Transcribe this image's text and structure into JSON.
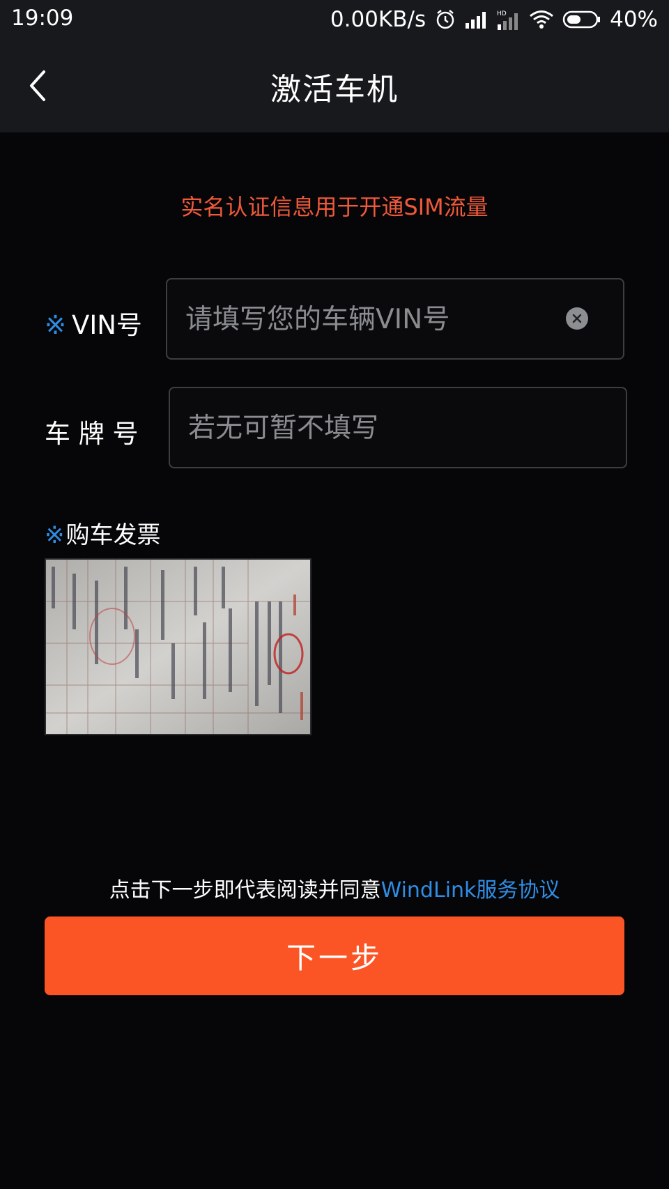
{
  "status_bar": {
    "time": "19:09",
    "network_speed": "0.00KB/s",
    "battery": "40%",
    "icons": [
      "alarm-icon",
      "signal-icon",
      "hd-signal-icon",
      "wifi-icon",
      "battery-icon"
    ]
  },
  "nav": {
    "title": "激活车机",
    "back_icon": "chevron-left-icon"
  },
  "notice": "实名认证信息用于开通SIM流量",
  "form": {
    "required_mark": "※",
    "vin": {
      "label": "VIN号",
      "placeholder": "请填写您的车辆VIN号",
      "value": ""
    },
    "plate": {
      "label": "车 牌 号",
      "placeholder": "若无可暂不填写",
      "value": ""
    },
    "invoice": {
      "label": "购车发票"
    }
  },
  "agreement": {
    "prefix": "点击下一步即代表阅读并同意",
    "link": "WindLink服务协议"
  },
  "next_button": "下一步",
  "colors": {
    "accent_orange": "#fb5526",
    "notice_red": "#f0593a",
    "link_blue": "#2f8de4",
    "background": "#060608",
    "bar": "#17191d"
  }
}
